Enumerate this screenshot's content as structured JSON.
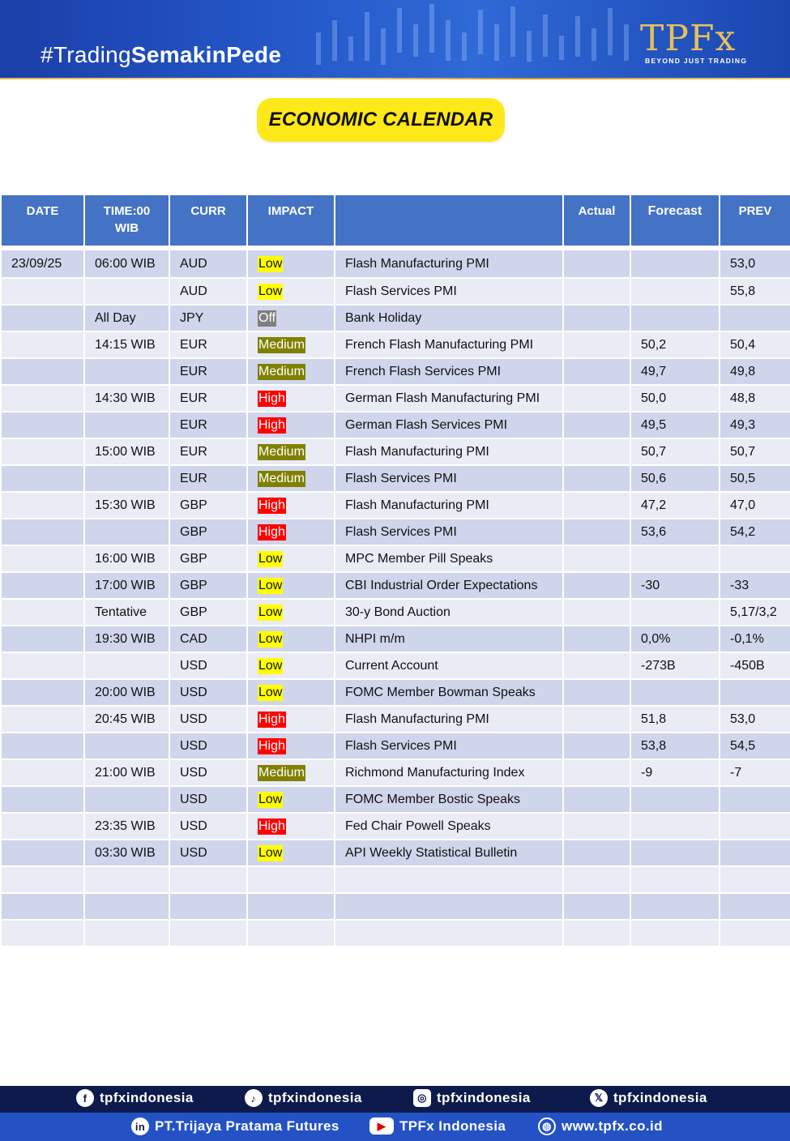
{
  "header": {
    "hashtag_prefix": "#Trading",
    "hashtag_bold": "SemakinPede",
    "logo_text": "TPFx",
    "logo_tagline": "BEYOND JUST TRADING"
  },
  "title": "ECONOMIC CALENDAR",
  "table": {
    "headers": {
      "date": "DATE",
      "time_line1": "TIME:00",
      "time_line2": "WIB",
      "curr": "CURR",
      "impact": "IMPACT",
      "event": "",
      "actual": "Actual",
      "forecast": "Forecast",
      "prev": "PREV"
    },
    "rows": [
      {
        "date": "23/09/25",
        "time": "06:00 WIB",
        "curr": "AUD",
        "impact": "Low",
        "event": "Flash Manufacturing PMI",
        "actual": "",
        "forecast": "",
        "prev": "53,0"
      },
      {
        "date": "",
        "time": "",
        "curr": "AUD",
        "impact": "Low",
        "event": "Flash Services PMI",
        "actual": "",
        "forecast": "",
        "prev": "55,8"
      },
      {
        "date": "",
        "time": "All Day",
        "curr": "JPY",
        "impact": "Off",
        "event": "Bank Holiday",
        "actual": "",
        "forecast": "",
        "prev": ""
      },
      {
        "date": "",
        "time": "14:15 WIB",
        "curr": "EUR",
        "impact": "Medium",
        "event": "French Flash Manufacturing PMI",
        "actual": "",
        "forecast": "50,2",
        "prev": "50,4"
      },
      {
        "date": "",
        "time": "",
        "curr": "EUR",
        "impact": "Medium",
        "event": "French Flash Services PMI",
        "actual": "",
        "forecast": "49,7",
        "prev": "49,8"
      },
      {
        "date": "",
        "time": "14:30 WIB",
        "curr": "EUR",
        "impact": "High",
        "event": "German Flash Manufacturing PMI",
        "actual": "",
        "forecast": "50,0",
        "prev": "48,8"
      },
      {
        "date": "",
        "time": "",
        "curr": "EUR",
        "impact": "High",
        "event": "German Flash Services PMI",
        "actual": "",
        "forecast": "49,5",
        "prev": "49,3"
      },
      {
        "date": "",
        "time": "15:00 WIB",
        "curr": "EUR",
        "impact": "Medium",
        "event": "Flash Manufacturing PMI",
        "actual": "",
        "forecast": "50,7",
        "prev": "50,7"
      },
      {
        "date": "",
        "time": "",
        "curr": "EUR",
        "impact": "Medium",
        "event": "Flash Services PMI",
        "actual": "",
        "forecast": "50,6",
        "prev": "50,5"
      },
      {
        "date": "",
        "time": "15:30 WIB",
        "curr": "GBP",
        "impact": "High",
        "event": "Flash Manufacturing PMI",
        "actual": "",
        "forecast": "47,2",
        "prev": "47,0"
      },
      {
        "date": "",
        "time": "",
        "curr": "GBP",
        "impact": "High",
        "event": "Flash Services PMI",
        "actual": "",
        "forecast": "53,6",
        "prev": "54,2"
      },
      {
        "date": "",
        "time": "16:00 WIB",
        "curr": "GBP",
        "impact": "Low",
        "event": "MPC Member Pill Speaks",
        "actual": "",
        "forecast": "",
        "prev": ""
      },
      {
        "date": "",
        "time": "17:00 WIB",
        "curr": "GBP",
        "impact": "Low",
        "event": "CBI Industrial Order Expectations",
        "actual": "",
        "forecast": "-30",
        "prev": "-33"
      },
      {
        "date": "",
        "time": "Tentative",
        "curr": "GBP",
        "impact": "Low",
        "event": "30-y Bond Auction",
        "actual": "",
        "forecast": "",
        "prev": "5,17/3,2"
      },
      {
        "date": "",
        "time": "19:30 WIB",
        "curr": "CAD",
        "impact": "Low",
        "event": "NHPI m/m",
        "actual": "",
        "forecast": "0,0%",
        "prev": "-0,1%"
      },
      {
        "date": "",
        "time": "",
        "curr": "USD",
        "impact": "Low",
        "event": "Current Account",
        "actual": "",
        "forecast": "-273B",
        "prev": "-450B"
      },
      {
        "date": "",
        "time": "20:00 WIB",
        "curr": "USD",
        "impact": "Low",
        "event": "FOMC Member Bowman Speaks",
        "actual": "",
        "forecast": "",
        "prev": ""
      },
      {
        "date": "",
        "time": "20:45 WIB",
        "curr": "USD",
        "impact": "High",
        "event": "Flash Manufacturing PMI",
        "actual": "",
        "forecast": "51,8",
        "prev": "53,0"
      },
      {
        "date": "",
        "time": "",
        "curr": "USD",
        "impact": "High",
        "event": "Flash Services PMI",
        "actual": "",
        "forecast": "53,8",
        "prev": "54,5"
      },
      {
        "date": "",
        "time": "21:00 WIB",
        "curr": "USD",
        "impact": "Medium",
        "event": "Richmond Manufacturing Index",
        "actual": "",
        "forecast": "-9",
        "prev": "-7"
      },
      {
        "date": "",
        "time": "",
        "curr": "USD",
        "impact": "Low",
        "event": "FOMC Member Bostic Speaks",
        "actual": "",
        "forecast": "",
        "prev": ""
      },
      {
        "date": "",
        "time": "23:35 WIB",
        "curr": "USD",
        "impact": "High",
        "event": "Fed Chair Powell Speaks",
        "actual": "",
        "forecast": "",
        "prev": ""
      },
      {
        "date": "",
        "time": "03:30 WIB",
        "curr": "USD",
        "impact": "Low",
        "event": "API Weekly Statistical Bulletin",
        "actual": "",
        "forecast": "",
        "prev": ""
      },
      {
        "date": "",
        "time": "",
        "curr": "",
        "impact": "",
        "event": "",
        "actual": "",
        "forecast": "",
        "prev": ""
      },
      {
        "date": "",
        "time": "",
        "curr": "",
        "impact": "",
        "event": "",
        "actual": "",
        "forecast": "",
        "prev": ""
      },
      {
        "date": "",
        "time": "",
        "curr": "",
        "impact": "",
        "event": "",
        "actual": "",
        "forecast": "",
        "prev": ""
      }
    ]
  },
  "footer": {
    "facebook": "tpfxindonesia",
    "tiktok": "tpfxindonesia",
    "instagram": "tpfxindonesia",
    "x": "tpfxindonesia",
    "linkedin": "PT.Trijaya Pratama Futures",
    "youtube": "TPFx Indonesia",
    "website": "www.tpfx.co.id"
  },
  "colors": {
    "header_blue": "#4472c4",
    "row_dark": "#cfd5ea",
    "row_light": "#e9ebf5",
    "impact_low": "#ffff00",
    "impact_medium": "#808000",
    "impact_high": "#ff0000",
    "impact_off": "#7f7f7f",
    "title_yellow": "#ffe81a",
    "footer_dark": "#0d1b4c",
    "footer_blue": "#2452c4"
  },
  "icons": [
    "facebook-icon",
    "tiktok-icon",
    "instagram-icon",
    "x-icon",
    "linkedin-icon",
    "youtube-icon",
    "globe-icon"
  ]
}
